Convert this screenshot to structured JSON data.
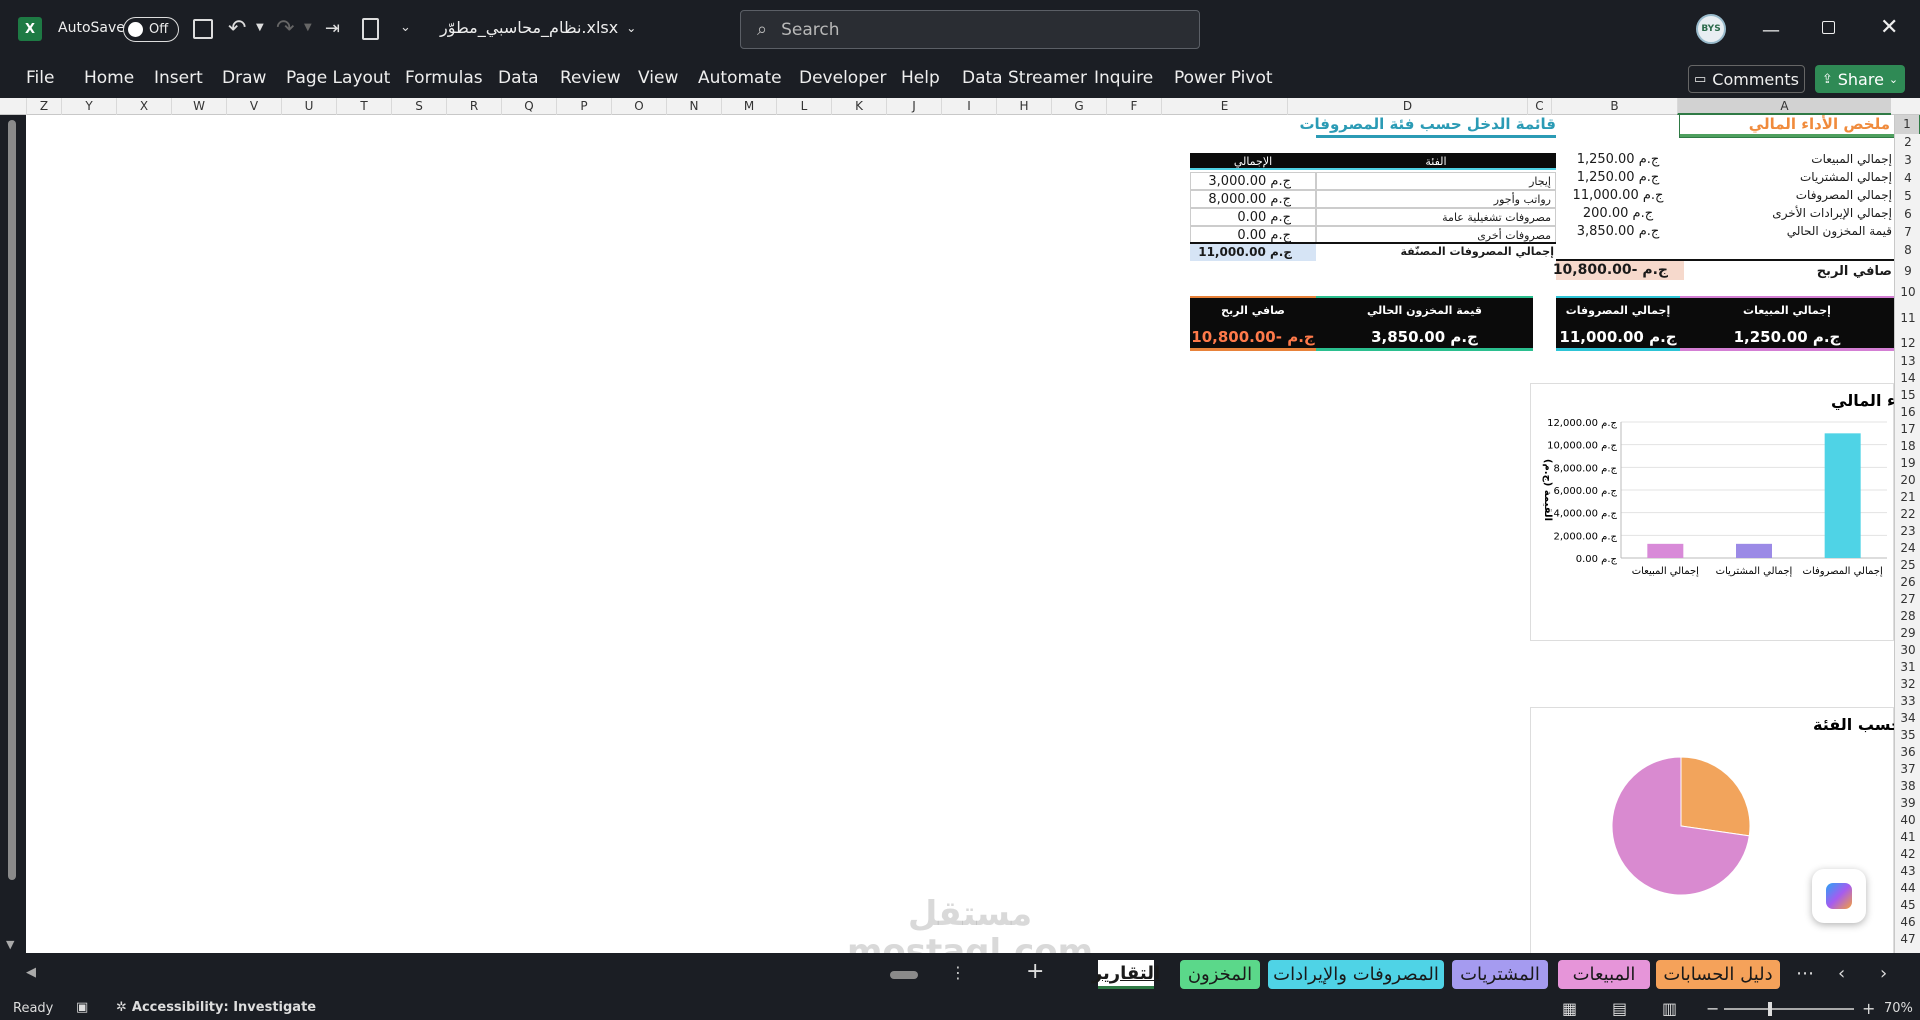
{
  "titlebar": {
    "autosave_label": "AutoSave",
    "autosave_state": "Off",
    "filename": "نظام_محاسبي_مطوّر.xlsx",
    "search_placeholder": "Search",
    "avatar_text": "BYS"
  },
  "menu": [
    "File",
    "Home",
    "Insert",
    "Draw",
    "Page Layout",
    "Formulas",
    "Data",
    "Review",
    "View",
    "Automate",
    "Developer",
    "Help",
    "Data Streamer",
    "Inquire",
    "Power Pivot"
  ],
  "comments_label": "Comments",
  "share_label": "Share",
  "columns": [
    "Z",
    "Y",
    "X",
    "W",
    "V",
    "U",
    "T",
    "S",
    "R",
    "Q",
    "P",
    "O",
    "N",
    "M",
    "L",
    "K",
    "J",
    "I",
    "H",
    "G",
    "F",
    "E",
    "D",
    "C",
    "B",
    "A"
  ],
  "rows": [
    "1",
    "2",
    "3",
    "4",
    "5",
    "6",
    "7",
    "8",
    "9",
    "10",
    "11",
    "12",
    "13",
    "14",
    "15",
    "16",
    "17",
    "18",
    "19",
    "20",
    "21",
    "22",
    "23",
    "24",
    "25",
    "26",
    "27",
    "28",
    "29",
    "30",
    "31",
    "32",
    "33",
    "34",
    "35",
    "36",
    "37",
    "38",
    "39",
    "40",
    "41",
    "42",
    "43",
    "44",
    "45",
    "46",
    "47"
  ],
  "summary": {
    "title": "ملخص الأداء المالي",
    "rows": [
      {
        "label": "إجمالي المبيعات",
        "value": "ج.م 1,250.00"
      },
      {
        "label": "إجمالي المشتريات",
        "value": "ج.م 1,250.00"
      },
      {
        "label": "إجمالي المصروفات",
        "value": "ج.م 11,000.00"
      },
      {
        "label": "إجمالي الإيرادات الأخرى",
        "value": "ج.م 200.00"
      },
      {
        "label": "قيمة المخزون الحالي",
        "value": "ج.م 3,850.00"
      }
    ],
    "profit_label": "صافي الربح",
    "profit_value": "ج.م -10,800.00"
  },
  "expenses": {
    "title": "قائمة الدخل حسب فئة المصروفات",
    "header_category": "الفئة",
    "header_total": "الإجمالي",
    "rows": [
      {
        "category": "إيجار",
        "total": "ج.م 3,000.00"
      },
      {
        "category": "رواتب وأجور",
        "total": "ج.م 8,000.00"
      },
      {
        "category": "مصروفات تشغيلية عامة",
        "total": "ج.م 0.00"
      },
      {
        "category": "مصروفات أخرى",
        "total": "ج.م 0.00"
      }
    ],
    "total_label": "إجمالي المصروفات المصنّفة",
    "total_value": "ج.م 11,000.00"
  },
  "kpis": [
    {
      "label": "إجمالي المبيعات",
      "value": "ج.م 1,250.00",
      "color": "#d47fd4"
    },
    {
      "label": "إجمالي المصروفات",
      "value": "ج.م 11,000.00",
      "color": "#2ec4d6"
    },
    {
      "label": "قيمة المخزون الحالي",
      "value": "ج.م 3,850.00",
      "color": "#2bbf8f"
    },
    {
      "label": "صافي الربح",
      "value": "ج.م -10,800.00",
      "color": "#e8823a"
    }
  ],
  "chart_data": [
    {
      "type": "bar",
      "title": "مقارنة الأداء المالي",
      "ylabel": "القيمة (ج.م)",
      "categories": [
        "إجمالي المبيعات",
        "إجمالي المشتريات",
        "إجمالي المصروفات"
      ],
      "values": [
        1250,
        1250,
        11000
      ],
      "colors": [
        "#d88ad8",
        "#9b8ae6",
        "#4fd3e6"
      ],
      "ylim": [
        0,
        12000
      ],
      "yticks": [
        "ج.م 0.00",
        "ج.م 2,000.00",
        "ج.م 4,000.00",
        "ج.م 6,000.00",
        "ج.م 8,000.00",
        "ج.م 10,000.00",
        "ج.م 12,000.00"
      ]
    },
    {
      "type": "pie",
      "title": "تفصيل المصروفات حسب الفئة",
      "categories": [
        "إيجار",
        "رواتب وأجور"
      ],
      "values": [
        3000,
        8000
      ],
      "colors": [
        "#f2a45c",
        "#d98ad0"
      ]
    }
  ],
  "sheet_tabs": [
    {
      "label": "التقارير",
      "color": "#ffffff",
      "active": true
    },
    {
      "label": "المخزون",
      "color": "#5bd88a"
    },
    {
      "label": "المصروفات والإيرادات",
      "color": "#4fd3e6"
    },
    {
      "label": "المشتريات",
      "color": "#a59bf0"
    },
    {
      "label": "المبيعات",
      "color": "#e695d9"
    },
    {
      "label": "دليل الحسابات",
      "color": "#f5a25a"
    }
  ],
  "status": {
    "ready": "Ready",
    "accessibility": "Accessibility: Investigate",
    "zoom": "70%"
  },
  "watermark": "مستقل mostaql.com"
}
